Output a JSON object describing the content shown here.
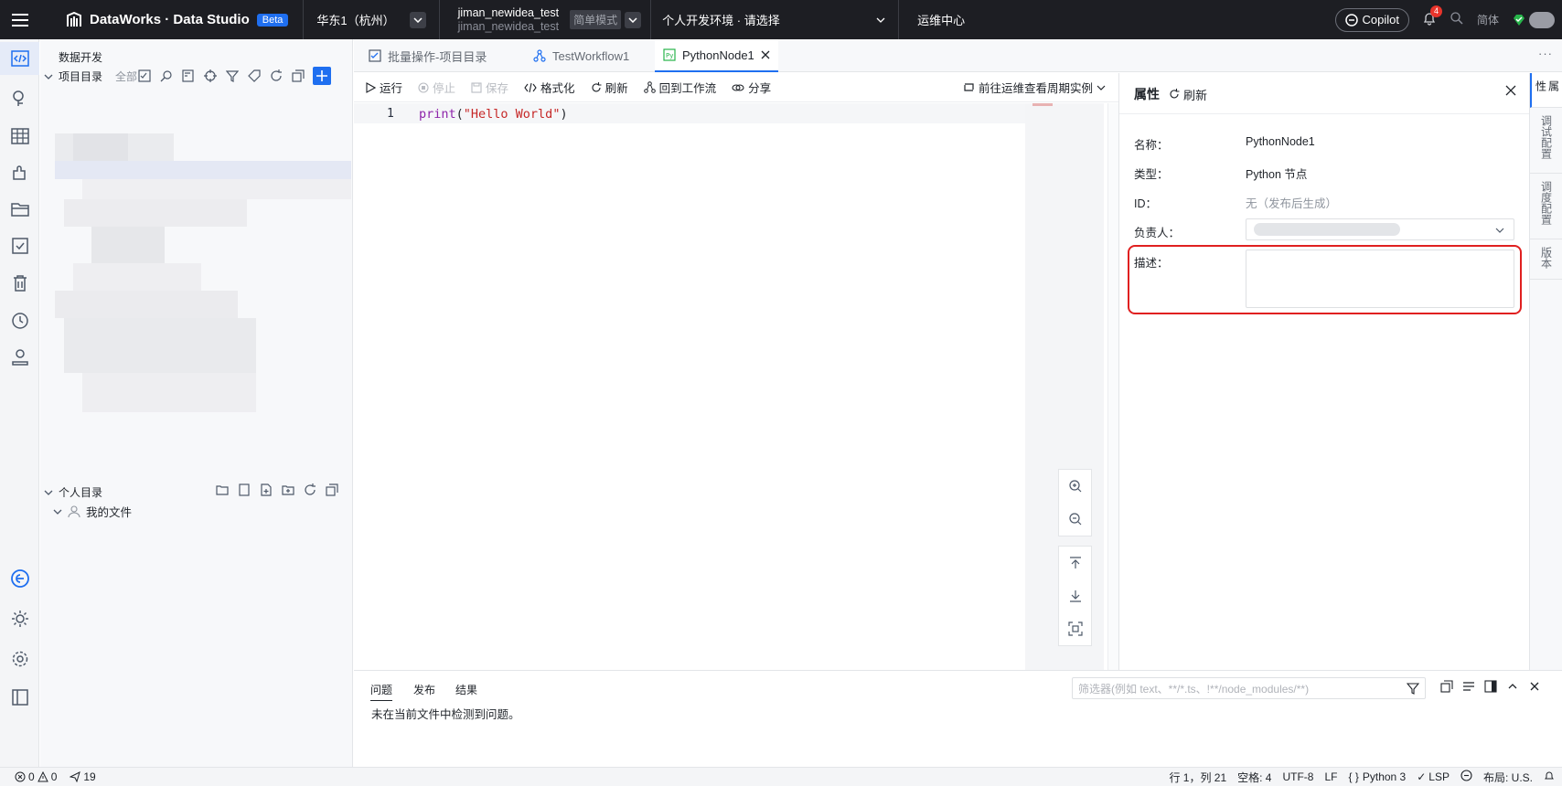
{
  "topbar": {
    "product": "DataWorks · Data Studio",
    "beta": "Beta",
    "region": "华东1（杭州）",
    "workspace_name": "jiman_newidea_test",
    "workspace_id": "jiman_newidea_test",
    "mode": "简单模式",
    "env": "个人开发环境 · 请选择",
    "ops_center": "运维中心",
    "copilot": "Copilot",
    "notifications": "4",
    "language": "简体"
  },
  "explorer": {
    "title": "数据开发",
    "project_dir": "项目目录",
    "project_filter": "全部",
    "personal_dir": "个人目录",
    "my_files": "我的文件"
  },
  "tabs": [
    {
      "label": "批量操作-项目目录"
    },
    {
      "label": "TestWorkflow1"
    },
    {
      "label": "PythonNode1"
    }
  ],
  "toolbar": {
    "run": "运行",
    "stop": "停止",
    "save": "保存",
    "format": "格式化",
    "refresh": "刷新",
    "back_workflow": "回到工作流",
    "share": "分享",
    "goto_ops": "前往运维查看周期实例"
  },
  "editor": {
    "line_number": "1",
    "code_fn": "print",
    "code_open": "(",
    "code_str": "\"Hello World\"",
    "code_close": ")"
  },
  "properties": {
    "title": "属性",
    "refresh": "刷新",
    "name_label": "名称：",
    "name_value": "PythonNode1",
    "type_label": "类型：",
    "type_value": "Python 节点",
    "id_label": "ID：",
    "id_value": "无（发布后生成）",
    "owner_label": "负责人：",
    "desc_label": "描述："
  },
  "rail": [
    {
      "label": "属性"
    },
    {
      "label": "调试配置"
    },
    {
      "label": "调度配置"
    },
    {
      "label": "版本"
    }
  ],
  "bottom": {
    "tab_problems": "问题",
    "tab_publish": "发布",
    "tab_results": "结果",
    "message": "未在当前文件中检测到问题。",
    "filter_placeholder": "筛选器(例如 text、**/*.ts、!**/node_modules/**)"
  },
  "status": {
    "errors": "0",
    "warnings": "0",
    "commits": "19",
    "cursor": "行 1，列 21",
    "indent": "空格: 4",
    "encoding": "UTF-8",
    "eol": "LF",
    "language": "Python 3",
    "lsp": "LSP",
    "layout": "布局: U.S."
  },
  "colors": {
    "topbar_bg": "#1d1e23",
    "accent": "#1f6ff0",
    "highlight": "#e02020"
  }
}
